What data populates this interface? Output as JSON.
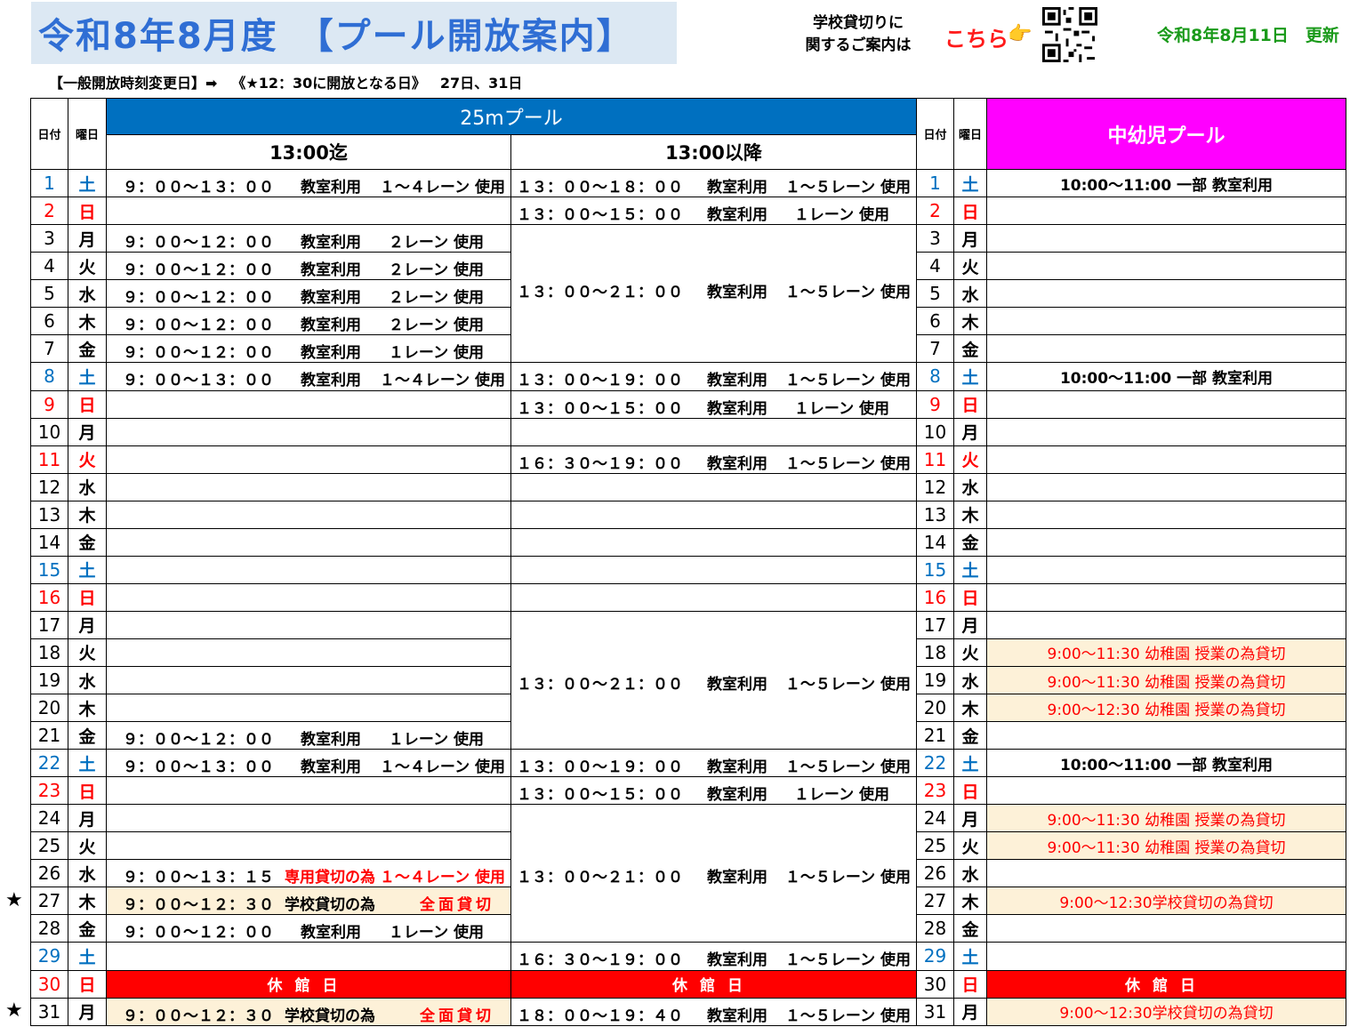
{
  "header": {
    "title": "令和8年8月度　【プール開放案内】",
    "notice_line1": "学校貸切りに",
    "notice_line2": "関するご案内は",
    "link": "こちら",
    "updated": "令和8年8月11日　更新"
  },
  "change_notice": {
    "label": "【一般開放時刻変更日】➡",
    "detail": "《★12：30に開放となる日》",
    "days": "27日、31日"
  },
  "columns": {
    "date": "日付",
    "dow": "曜日",
    "pool25": "25mプール",
    "until13": "13:00迄",
    "after13": "13:00以降",
    "kids_pool": "中幼児プール"
  },
  "texts": {
    "class_use": "教室利用",
    "closed": "休館日",
    "closed_kids": "休館日",
    "kid_partial": "10:00〜11:00 一部 教室利用",
    "kinder_1130": "9:00〜11:30 幼稚園 授業の為貸切",
    "kinder_1230": "9:00〜12:30 幼稚園 授業の為貸切",
    "school_1230": "9:00〜12:30学校貸切の為貸切",
    "am_0913": "９：００〜１３：００",
    "am_0912": "９：００〜１２：００",
    "am_091315": "９：００〜１３：１５",
    "am_091230": "９：００〜１２：３０",
    "pm_1318": "１３：００〜１８：００",
    "pm_1315": "１３：００〜１５：００",
    "pm_1321": "１３：００〜２１：００",
    "pm_1319": "１３：００〜１９：００",
    "pm_16301900": "１６：３０〜１９：００",
    "pm_16301900b": "１６：３０〜１９：００",
    "pm_18001940": "１８：００〜１９：４０",
    "lane14": "１〜４レーン 使用",
    "lane15": "１〜５レーン 使用",
    "lane1": "１レーン 使用",
    "lane1b": "１レーン 使用",
    "lane2": "２レーン 使用",
    "exclusive": "専用貸切の為",
    "school_rent": "学校貸切の為",
    "full_rent": "全面貸切",
    "star": "★"
  },
  "days": [
    {
      "d": "1",
      "w": "土"
    },
    {
      "d": "2",
      "w": "日"
    },
    {
      "d": "3",
      "w": "月"
    },
    {
      "d": "4",
      "w": "火"
    },
    {
      "d": "5",
      "w": "水"
    },
    {
      "d": "6",
      "w": "木"
    },
    {
      "d": "7",
      "w": "金"
    },
    {
      "d": "8",
      "w": "土"
    },
    {
      "d": "9",
      "w": "日"
    },
    {
      "d": "10",
      "w": "月"
    },
    {
      "d": "11",
      "w": "火"
    },
    {
      "d": "12",
      "w": "水"
    },
    {
      "d": "13",
      "w": "木"
    },
    {
      "d": "14",
      "w": "金"
    },
    {
      "d": "15",
      "w": "土"
    },
    {
      "d": "16",
      "w": "日"
    },
    {
      "d": "17",
      "w": "月"
    },
    {
      "d": "18",
      "w": "火"
    },
    {
      "d": "19",
      "w": "水"
    },
    {
      "d": "20",
      "w": "木"
    },
    {
      "d": "21",
      "w": "金"
    },
    {
      "d": "22",
      "w": "土"
    },
    {
      "d": "23",
      "w": "日"
    },
    {
      "d": "24",
      "w": "月"
    },
    {
      "d": "25",
      "w": "火"
    },
    {
      "d": "26",
      "w": "水"
    },
    {
      "d": "27",
      "w": "木"
    },
    {
      "d": "28",
      "w": "金"
    },
    {
      "d": "29",
      "w": "土"
    },
    {
      "d": "30",
      "w": "日"
    },
    {
      "d": "31",
      "w": "月"
    }
  ],
  "colors": {
    "title": "#2f6ed4",
    "pool25": "#0070c0",
    "kids": "#ff00ff",
    "sat": "#0070c0",
    "sun": "#ff0000",
    "rent_bg": "#fdf1d8",
    "updated": "#1a9a1a"
  }
}
